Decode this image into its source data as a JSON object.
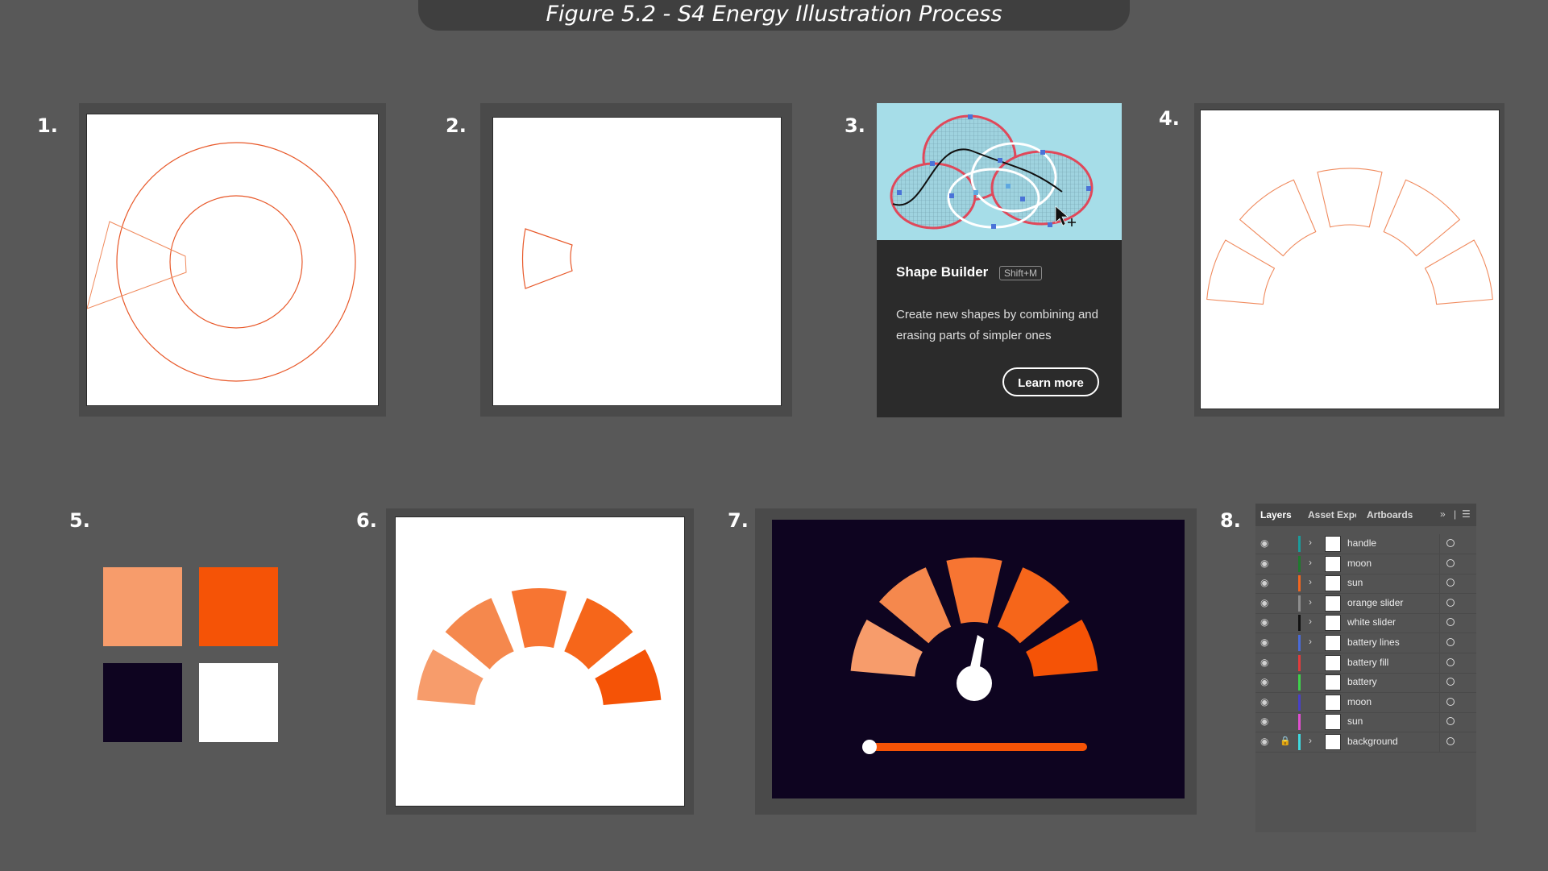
{
  "figure": {
    "title": "Figure 5.2 - S4 Energy Illustration Process"
  },
  "steps": [
    "1.",
    "2.",
    "3.",
    "4.",
    "5.",
    "6.",
    "7.",
    "8."
  ],
  "colors": {
    "background": "#585858",
    "light_orange": "#f79c6b",
    "orange": "#f55306",
    "dark_navy": "#0e0420",
    "white": "#ffffff",
    "outline": "#e8592a"
  },
  "shape_builder": {
    "title": "Shape Builder",
    "shortcut": "Shift+M",
    "description": "Create new shapes by combining and erasing parts of simpler ones",
    "button": "Learn more"
  },
  "layers_panel": {
    "tabs": [
      "Layers",
      "Asset Expo",
      "Artboards"
    ],
    "expand_icon": "double-chevron-icon",
    "menu_icon": "hamburger-icon",
    "layers": [
      {
        "name": "handle",
        "color": "#1a9c9c",
        "expandable": true,
        "locked": false
      },
      {
        "name": "moon",
        "color": "#1f7a2e",
        "expandable": true,
        "locked": false
      },
      {
        "name": "sun",
        "color": "#f2661f",
        "expandable": true,
        "locked": false
      },
      {
        "name": "orange slider",
        "color": "#8e8e8e",
        "expandable": true,
        "locked": false
      },
      {
        "name": "white slider",
        "color": "#111111",
        "expandable": true,
        "locked": false
      },
      {
        "name": "battery lines",
        "color": "#4a6bd8",
        "expandable": true,
        "locked": false
      },
      {
        "name": "battery fill",
        "color": "#e33b3b",
        "expandable": false,
        "locked": false
      },
      {
        "name": "battery",
        "color": "#3ed24a",
        "expandable": false,
        "locked": false
      },
      {
        "name": "moon",
        "color": "#4840c8",
        "expandable": false,
        "locked": false
      },
      {
        "name": "sun",
        "color": "#e04fd0",
        "expandable": false,
        "locked": false
      },
      {
        "name": "background",
        "color": "#3fd9e0",
        "expandable": true,
        "locked": true
      }
    ]
  }
}
